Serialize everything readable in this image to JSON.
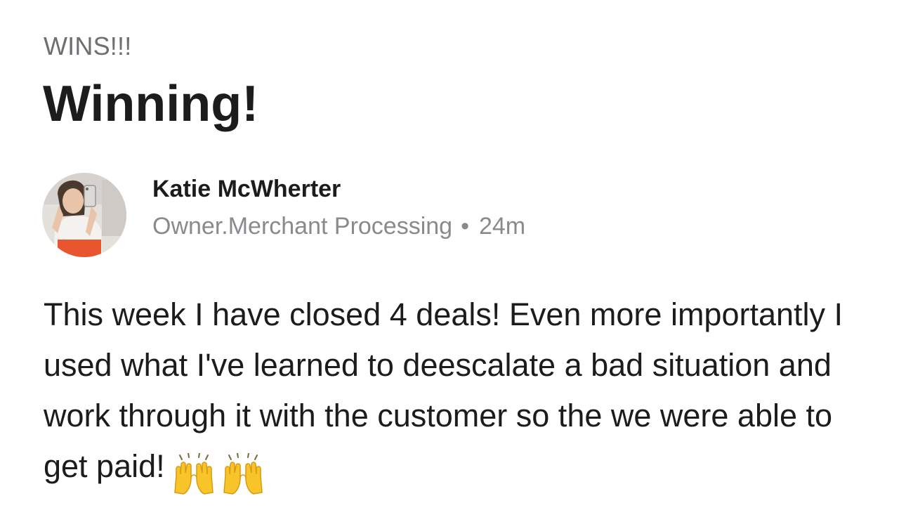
{
  "post": {
    "category": "WINS!!!",
    "title": "Winning!",
    "author": {
      "name": "Katie McWherter",
      "role": "Owner.Merchant Processing",
      "separator": "•",
      "time": "24m"
    },
    "body": "This week I have closed 4 deals! Even more importantly I used what I've learned to deescalate a bad situation and work through it with the customer so the we were able to get paid!",
    "emojis": [
      "raising-hands-emoji",
      "raising-hands-emoji"
    ]
  },
  "colors": {
    "text_primary": "#1c1c1e",
    "text_secondary": "#8a8a8e",
    "category": "#6e6e73",
    "emoji_yellow": "#f7c52a"
  }
}
